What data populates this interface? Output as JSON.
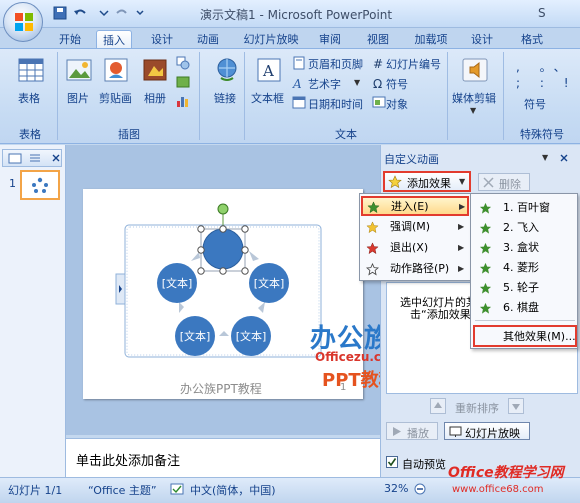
{
  "title": "演示文稿1 - Microsoft PowerPoint",
  "title_cut": "S",
  "tabs": [
    "开始",
    "插入",
    "设计",
    "动画",
    "幻灯片放映",
    "审阅",
    "视图",
    "加载项",
    "设计",
    "格式"
  ],
  "ribbon": {
    "groups": {
      "table": "表格",
      "illustration": "插图",
      "text": "文本",
      "symbols": "特殊符号"
    },
    "table_btn": "表格",
    "picture_btn": "图片",
    "clipart_btn": "剪贴画",
    "album_btn": "相册",
    "link_btn": "链接",
    "textbox_btn": "文本框",
    "header_footer": "页眉和页脚",
    "wordart": "艺术字",
    "datetime": "日期和时间",
    "slide_number": "幻灯片编号",
    "symbol": "符号",
    "object": "对象",
    "media_btn": "媒体剪辑",
    "symbol_btn": "符号"
  },
  "slide": {
    "nodes": [
      "[文本]",
      "[文本]",
      "[文本]",
      "[文本]"
    ],
    "footer_text": "办公族PPT教程",
    "page_num": "1"
  },
  "thumbnail_num": "1",
  "notes_placeholder": "单击此处添加备注",
  "task_pane": {
    "title": "自定义动画",
    "add_effect": "添加效果",
    "delete": "删除",
    "hint_line1": "选中幻灯片的某",
    "hint_line2": "击“添加效果",
    "reorder": "重新排序",
    "play": "播放",
    "slideshow": "幻灯片放映",
    "autopreview": "自动预览"
  },
  "menu1": [
    {
      "label": "进入(E)"
    },
    {
      "label": "强调(M)"
    },
    {
      "label": "退出(X)"
    },
    {
      "label": "动作路径(P)"
    }
  ],
  "menu2": [
    {
      "label": "1. 百叶窗"
    },
    {
      "label": "2. 飞入"
    },
    {
      "label": "3. 盒状"
    },
    {
      "label": "4. 菱形"
    },
    {
      "label": "5. 轮子"
    },
    {
      "label": "6. 棋盘"
    },
    {
      "label": "其他效果(M)..."
    }
  ],
  "status": {
    "slide_info": "幻灯片 1/1",
    "theme": "“Office 主题”",
    "language": "中文(简体，中国)",
    "zoom": "32%"
  },
  "watermark": {
    "brand": "办公族",
    "site": "Officezu.com",
    "tag": "PPT教程",
    "corner_brand": "Office教程学习网",
    "corner_url": "www.office68.com"
  },
  "colors": {
    "accent": "#15428b",
    "node_fill": "#3b78c0",
    "highlight": "#ffd98c",
    "red_box": "#e23b2e"
  }
}
